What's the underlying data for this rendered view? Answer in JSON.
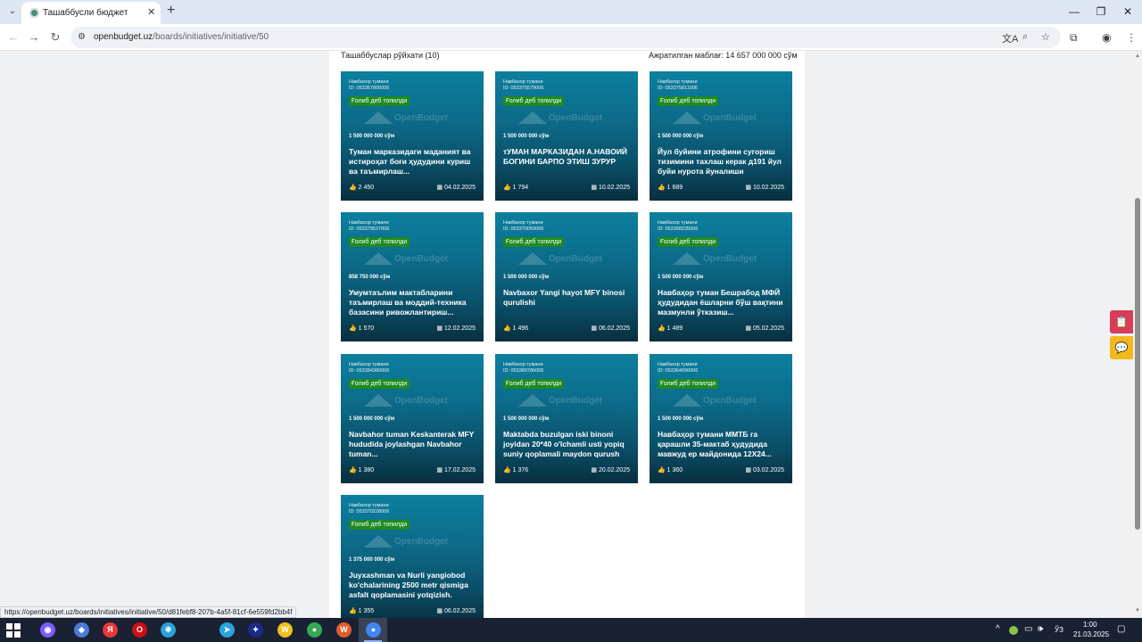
{
  "browser": {
    "tab": {
      "title": "Ташаббусли бюджет",
      "close_glyph": "✕"
    },
    "tab_search_glyph": "⌄",
    "new_tab_glyph": "+",
    "window_controls": {
      "minimize": "—",
      "restore": "❐",
      "close": "✕"
    },
    "nav": {
      "back": "←",
      "forward": "→",
      "reload": "↻"
    },
    "site_info_glyph": "⚙",
    "url": {
      "host": "openbudget.uz",
      "path": "/boards/initiatives/initiative/50"
    },
    "icons": {
      "translate": "文A",
      "zoom": "⌕",
      "bookmark": "☆",
      "extensions": "⧉",
      "profile": "◉",
      "menu": "⋮"
    }
  },
  "page": {
    "list_title": "Ташаббуслар рўйхати (10)",
    "allocated_budget": "Ажратилган маблағ: 14 657 000 000 сўм",
    "vote_glyph": "👍",
    "date_glyph": "▦",
    "watermark": "OpenBudget",
    "cards": [
      {
        "district": "Навбахор тумани",
        "id": "ID: 053367805006",
        "badge": "Ғолиб деб топилди",
        "amount": "1 500 000 000 сўм",
        "title": "Туман марказидаги маданият ва истироҳат боғи ҳудудини куриш ва таъмирлаш...",
        "votes": "2 450",
        "date": "04.02.2025"
      },
      {
        "district": "Навбахор тумани",
        "id": "ID: 053375579006",
        "badge": "Ғолиб деб топилди",
        "amount": "1 500 000 000 сўм",
        "title": "тУМАН МАРКАЗИДАН А.НАВОИЙ БОГИНИ БАРПО ЭТИШ ЗУРУР",
        "votes": "1 794",
        "date": "10.02.2025"
      },
      {
        "district": "Навбахор тумани",
        "id": "ID: 053375811006",
        "badge": "Ғолиб деб топилди",
        "amount": "1 500 000 000 сўм",
        "title": "Йул буйини атрофини сугориш тизимини тахлаш керак д191 йул буйи нурота йуналиши",
        "votes": "1 689",
        "date": "10.02.2025"
      },
      {
        "district": "Навбахор тумани",
        "id": "ID: 053379527006",
        "badge": "Ғолиб деб топилди",
        "amount": "858 750 000 сўм",
        "title": "Умумтаълим мактабларини таъмирлаш ва моддий-техника базасини ривожлантириш...",
        "votes": "1 570",
        "date": "12.02.2025"
      },
      {
        "district": "Навбахор тумани",
        "id": "ID: 053370059006",
        "badge": "Ғолиб деб топилди",
        "amount": "1 500 000 000 сўм",
        "title": "Navbaxor Yangi hayot MFY binosi qurulishi",
        "votes": "1 496",
        "date": "06.02.2025"
      },
      {
        "district": "Навбахор тумани",
        "id": "ID: 053368235006",
        "badge": "Ғолиб деб топилди",
        "amount": "1 500 000 000 сўм",
        "title": "Навбаҳор туман Бешрабод МФЙ ҳудудидан ёшларни бўш вақтини мазмунли ўтказиш...",
        "votes": "1 489",
        "date": "05.02.2025"
      },
      {
        "district": "Навбахор тумани",
        "id": "ID: 053384380006",
        "badge": "Ғолиб деб топилди",
        "amount": "1 500 000 000 сўм",
        "title": "Navbahor tuman Keskanterak MFY hududida joylashgan Navbahor tuman...",
        "votes": "1 380",
        "date": "17.02.2025"
      },
      {
        "district": "Навбахор тумани",
        "id": "ID: 053389786006",
        "badge": "Ғолиб деб топилди",
        "amount": "1 500 000 000 сўм",
        "title": "Maktabda buzulgan iski binoni joyidan 20*40 o'lchamli usti yopiq suniy qoplamali maydon qurush",
        "votes": "1 376",
        "date": "20.02.2025"
      },
      {
        "district": "Навбахор тумани",
        "id": "ID: 053364090006",
        "badge": "Ғолиб деб топилди",
        "amount": "1 500 000 000 сўм",
        "title": "Навбаҳор тумани ММТБ га қарашли 35-мактаб ҳудудида мавжуд ер майдонида 12X24...",
        "votes": "1 360",
        "date": "03.02.2025"
      },
      {
        "district": "Навбахор тумани",
        "id": "ID: 053370228006",
        "badge": "Ғолиб деб топилди",
        "amount": "1 375 000 000 сўм",
        "title": "Juyxashman va Nurli yangiobod ko'chalarining 2500 metr qismiga asfalt qoplamasini yotqizish.",
        "votes": "1 355",
        "date": "06.02.2025"
      }
    ],
    "side_buttons": {
      "top_glyph": "📋",
      "bottom_glyph": "💬",
      "top_color": "#d93b5a",
      "bottom_color": "#f3b81e"
    }
  },
  "status_url": "https://openbudget.uz/boards/initiatives/initiative/50/d81febf8-207b-4a5f-81cf-6e559fd2bb4f",
  "taskbar": {
    "apps": [
      {
        "name": "alice",
        "glyph": "◉",
        "color": "#7b5cff"
      },
      {
        "name": "app2",
        "glyph": "◆",
        "color": "#4a7bd6"
      },
      {
        "name": "yandex",
        "glyph": "Я",
        "color": "#e53935"
      },
      {
        "name": "opera",
        "glyph": "O",
        "color": "#cc0f16"
      },
      {
        "name": "app5",
        "glyph": "❄",
        "color": "#2aa3d8"
      },
      {
        "name": "telegram",
        "glyph": "➤",
        "color": "#2aa3e0"
      },
      {
        "name": "app7",
        "glyph": "✦",
        "color": "#1a2a8a"
      },
      {
        "name": "app8",
        "glyph": "W",
        "color": "#f0c020"
      },
      {
        "name": "chrome2",
        "glyph": "●",
        "color": "#34a853"
      },
      {
        "name": "app10",
        "glyph": "W",
        "color": "#e25a2b"
      },
      {
        "name": "chrome",
        "glyph": "●",
        "color": "#4285f4"
      }
    ],
    "tray": {
      "chevron": "^",
      "sound": "🕪",
      "lang": "ЎЗ"
    },
    "time": "1:00",
    "date": "21.03.2025"
  }
}
